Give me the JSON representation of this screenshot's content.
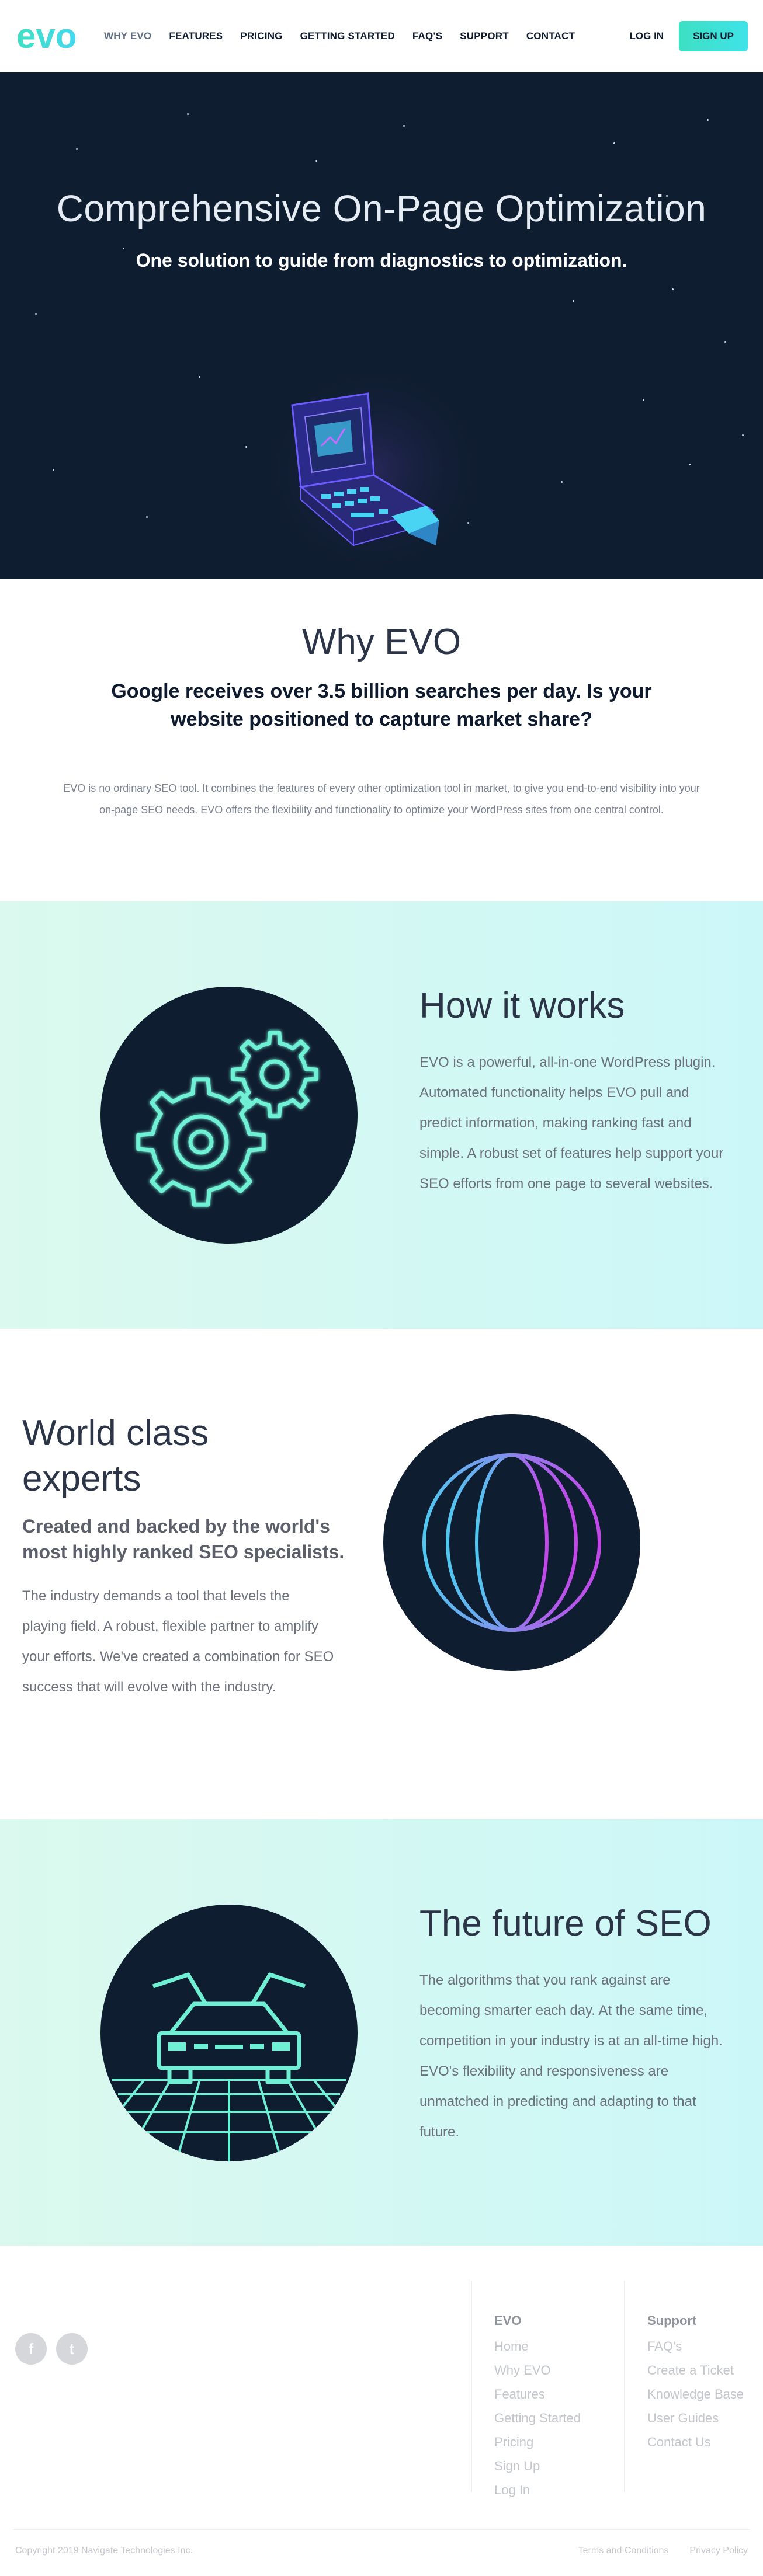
{
  "nav": {
    "logo_text": "evo",
    "links": [
      {
        "label": "WHY EVO",
        "active": true
      },
      {
        "label": "FEATURES"
      },
      {
        "label": "PRICING"
      },
      {
        "label": "GETTING STARTED"
      },
      {
        "label": "FAQ'S"
      },
      {
        "label": "SUPPORT"
      },
      {
        "label": "CONTACT"
      }
    ],
    "login": "LOG IN",
    "signup": "SIGN UP"
  },
  "hero": {
    "title": "Comprehensive On-Page Optimization",
    "subtitle": "One solution to guide from diagnostics to optimization.",
    "illustration": "retro-computer-icon"
  },
  "why": {
    "title": "Why EVO",
    "headline": "Google receives over 3.5 billion searches per day. Is your website positioned to capture market share?",
    "body": "EVO is no ordinary SEO tool. It combines the features of every other optimization tool in market, to give you end-to-end visibility into your on-page SEO needs. EVO offers the flexibility and functionality to optimize your WordPress sites from one central control."
  },
  "how": {
    "title": "How it works",
    "body": "EVO is a powerful, all-in-one WordPress plugin. Automated functionality helps EVO pull and predict information, making ranking fast and simple. A robust set of features help support your SEO efforts from one page to several websites.",
    "illustration": "gears-icon"
  },
  "experts": {
    "title": "World class experts",
    "subtitle": "Created and backed by the world's most highly ranked SEO specialists.",
    "body": "The industry demands a tool that levels the playing field. A robust, flexible partner to amplify your efforts. We've created a combination for SEO success that will evolve with the industry.",
    "illustration": "globe-icon"
  },
  "future": {
    "title": "The future of SEO",
    "body": "The algorithms that you rank against are becoming smarter each day. At the same time, competition in your industry is at an all-time high. EVO's flexibility and responsiveness are unmatched in predicting and adapting to that future.",
    "illustration": "car-icon"
  },
  "footer": {
    "social": [
      {
        "glyph": "f",
        "name": "facebook-icon"
      },
      {
        "glyph": "t",
        "name": "twitter-icon"
      }
    ],
    "evo_col": {
      "heading": "EVO",
      "links": [
        "Home",
        "Why EVO",
        "Features",
        "Getting Started",
        "Pricing",
        "Sign Up",
        "Log In"
      ]
    },
    "support_col": {
      "heading": "Support",
      "links": [
        "FAQ's",
        "Create a Ticket",
        "Knowledge Base",
        "User Guides",
        "Contact Us"
      ]
    },
    "copyright": "Copyright 2019 Navigate Technologies Inc.",
    "legal": [
      "Terms and Conditions",
      "Privacy Policy"
    ]
  },
  "colors": {
    "accent": "#3fe3d6",
    "navy": "#0f1d30",
    "purple": "#8f5cff"
  }
}
